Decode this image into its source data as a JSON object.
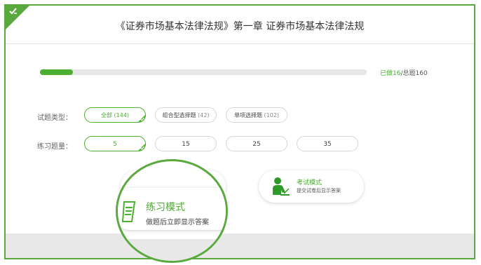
{
  "title": "《证券市场基本法律法规》第一章 证券市场基本法律法规",
  "progress": {
    "done_label": "已做16",
    "total_label": "/总题160",
    "fraction": 0.1
  },
  "question_type": {
    "label": "试题类型：",
    "options": [
      {
        "name": "全部",
        "count": "(144)",
        "selected": true
      },
      {
        "name": "组合型选择题",
        "count": "(42)",
        "selected": false
      },
      {
        "name": "单项选择题",
        "count": "(102)",
        "selected": false
      }
    ]
  },
  "question_count": {
    "label": "练习题量：",
    "options": [
      {
        "value": "5",
        "selected": true
      },
      {
        "value": "15",
        "selected": false
      },
      {
        "value": "25",
        "selected": false
      },
      {
        "value": "35",
        "selected": false
      }
    ]
  },
  "modes": {
    "practice": {
      "title": "练习模式",
      "desc": "做题后立即显示答案"
    },
    "exam": {
      "title": "考试模式",
      "desc": "提交试卷后显示答案"
    }
  },
  "colors": {
    "accent": "#4caf2f",
    "frame": "#5aa93e"
  },
  "icons": {
    "corner": "pen-check-icon",
    "exam": "person-writing-icon",
    "practice": "document-icon"
  }
}
